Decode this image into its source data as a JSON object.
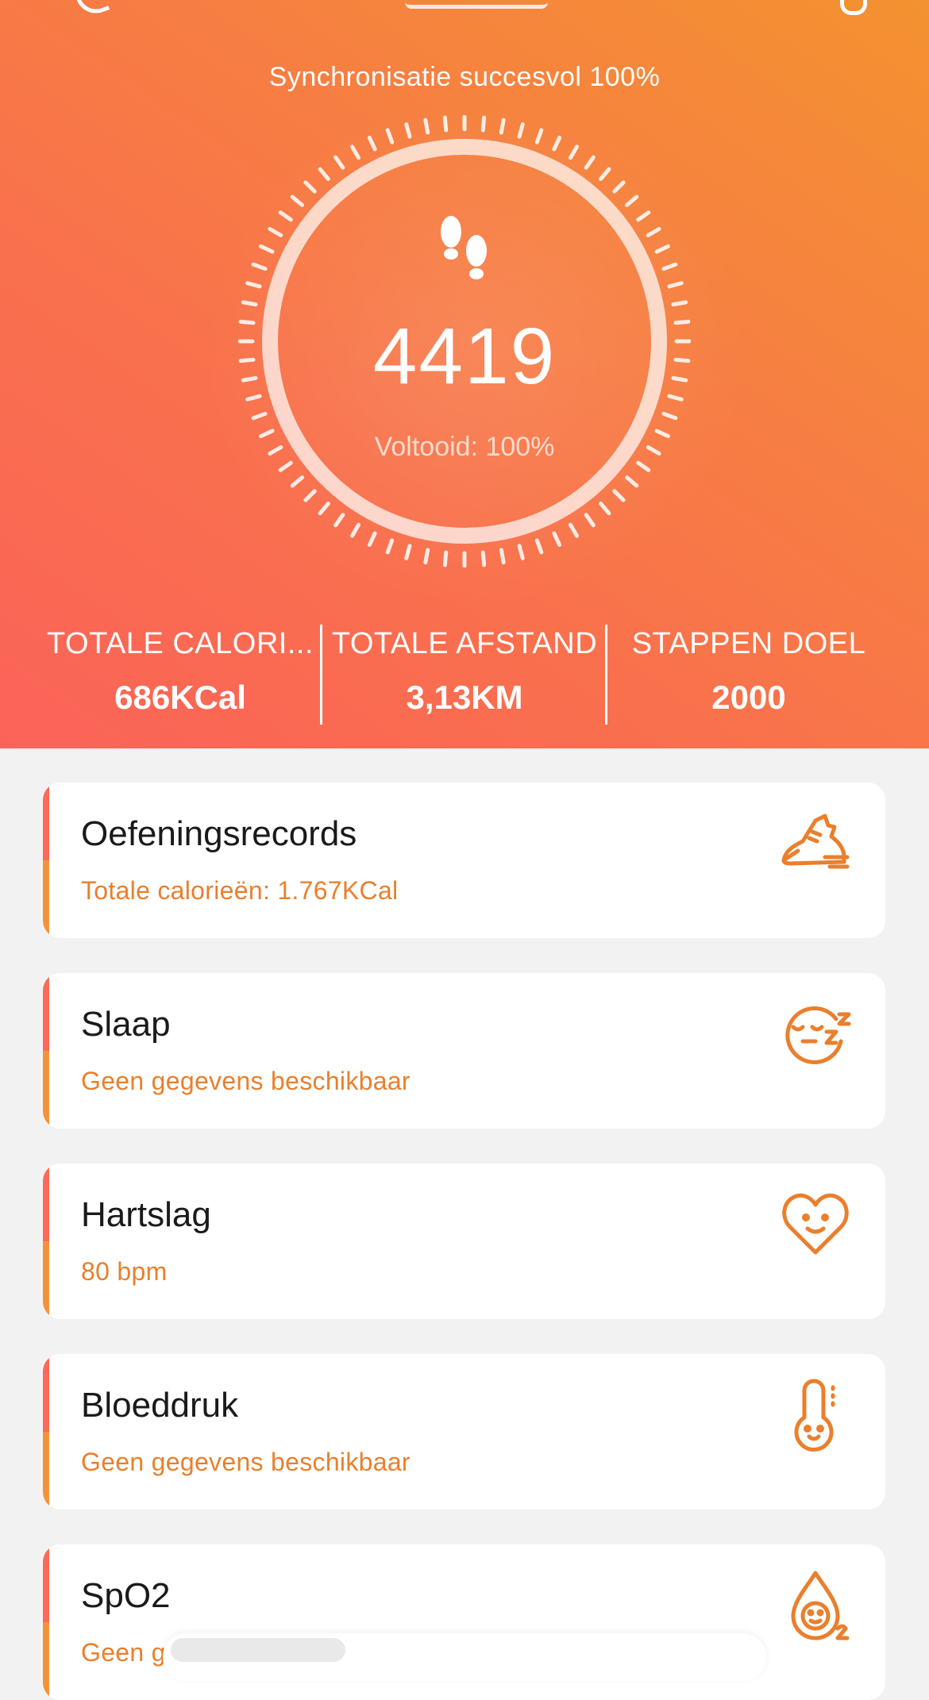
{
  "header": {
    "sync_status": "Synchronisatie succesvol 100%"
  },
  "steps": {
    "count": "4419",
    "completion": "Voltooid: 100%",
    "progress_fraction": 1.0
  },
  "stats": [
    {
      "label": "TOTALE CALORI...",
      "value": "686KCal"
    },
    {
      "label": "TOTALE AFSTAND",
      "value": "3,13KM"
    },
    {
      "label": "STAPPEN DOEL",
      "value": "2000"
    }
  ],
  "cards": [
    {
      "title": "Oefeningsrecords",
      "subtitle": "Totale calorieën: 1.767KCal",
      "icon": "running-shoe-icon"
    },
    {
      "title": "Slaap",
      "subtitle": "Geen gegevens beschikbaar",
      "icon": "sleep-face-icon"
    },
    {
      "title": "Hartslag",
      "subtitle": "80 bpm",
      "icon": "heart-face-icon"
    },
    {
      "title": "Bloeddruk",
      "subtitle": "Geen gegevens beschikbaar",
      "icon": "thermometer-face-icon"
    },
    {
      "title": "SpO2",
      "subtitle": "Geen g",
      "icon": "oxygen-drop-icon"
    }
  ],
  "colors": {
    "hero_top": "#f39230",
    "hero_bottom": "#fb6359",
    "accent_orange": "#ea7f2c",
    "card_accent_red": "#fb6a5a",
    "background": "#f2f2f2"
  }
}
